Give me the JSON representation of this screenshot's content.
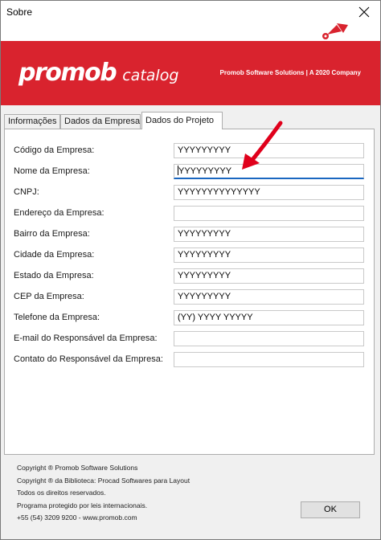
{
  "window": {
    "title": "Sobre"
  },
  "banner": {
    "logo_main": "promob",
    "logo_sub": "catalog",
    "tagline": "Promob Software Solutions | A 2020 Company",
    "color": "#d9232e"
  },
  "tabs": [
    {
      "label": "Informações",
      "active": false
    },
    {
      "label": "Dados da Empresa",
      "active": false
    },
    {
      "label": "Dados do Projeto",
      "active": true
    }
  ],
  "fields": [
    {
      "label": "Código da Empresa:",
      "value": "YYYYYYYYY"
    },
    {
      "label": "Nome da Empresa:",
      "value": "YYYYYYYYY"
    },
    {
      "label": "CNPJ:",
      "value": "YYYYYYYYYYYYYY"
    },
    {
      "label": "Endereço da Empresa:",
      "value": ""
    },
    {
      "label": "Bairro da Empresa:",
      "value": "YYYYYYYYY"
    },
    {
      "label": "Cidade da Empresa:",
      "value": "YYYYYYYYY"
    },
    {
      "label": "Estado da Empresa:",
      "value": "YYYYYYYYY"
    },
    {
      "label": "CEP da Empresa:",
      "value": "YYYYYYYYY"
    },
    {
      "label": "Telefone da Empresa:",
      "value": "(YY) YYYY YYYYY"
    },
    {
      "label": "E-mail do Responsável da Empresa:",
      "value": ""
    },
    {
      "label": "Contato do Responsável da Empresa:",
      "value": ""
    }
  ],
  "footer": {
    "lines": [
      "Copyright ® Promob Software Solutions",
      "Copyright ® da Biblioteca: Procad Softwares para Layout",
      "Todos os direitos reservados.",
      "Programa protegido por leis internacionais.",
      "+55 (54) 3209 9200  -  www.promob.com"
    ]
  },
  "ok_label": "OK",
  "icons": {
    "close": "close-icon",
    "annotation": "red-arrow-icon",
    "brand_mark": "promob-mark-icon"
  }
}
